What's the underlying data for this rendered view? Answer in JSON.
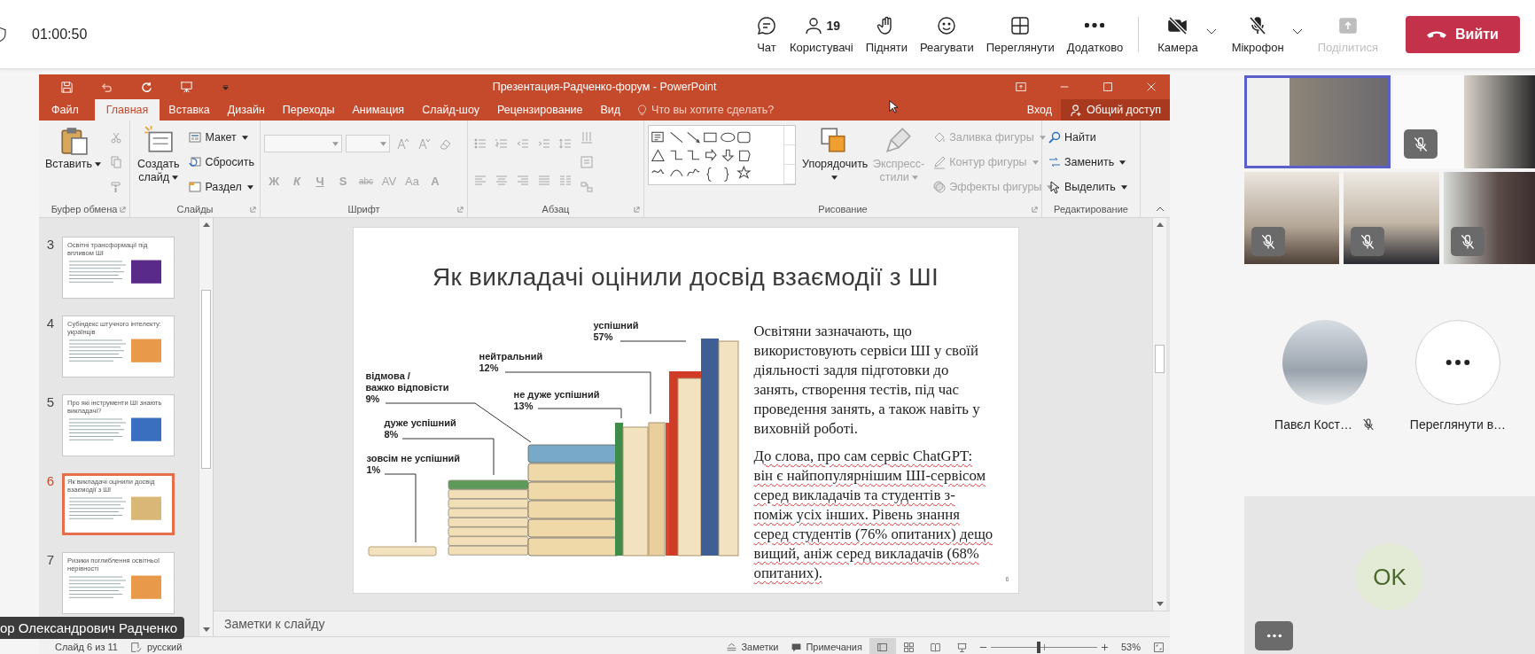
{
  "meeting_toolbar": {
    "timer": "01:00:50",
    "actions": [
      {
        "kind": "chat",
        "label": "Чат"
      },
      {
        "kind": "people",
        "label": "Користувачі",
        "count": "19"
      },
      {
        "kind": "raise-hand",
        "label": "Підняти"
      },
      {
        "kind": "react",
        "label": "Реагувати"
      },
      {
        "kind": "view",
        "label": "Переглянути"
      },
      {
        "kind": "more",
        "label": "Додатково"
      }
    ],
    "camera": {
      "label": "Камера",
      "on": false
    },
    "microphone": {
      "label": "Мікрофон",
      "on": false
    },
    "share": {
      "label": "Поділитися",
      "disabled": true
    },
    "leave": {
      "label": "Вийти"
    }
  },
  "powerpoint": {
    "title": "Презентация-Радченко-форум - PowerPoint",
    "tabs": [
      {
        "label": "Файл",
        "selected": false
      },
      {
        "label": "Главная",
        "selected": true
      },
      {
        "label": "Вставка",
        "selected": false
      },
      {
        "label": "Дизайн",
        "selected": false
      },
      {
        "label": "Переходы",
        "selected": false
      },
      {
        "label": "Анимация",
        "selected": false
      },
      {
        "label": "Слайд-шоу",
        "selected": false
      },
      {
        "label": "Рецензирование",
        "selected": false
      },
      {
        "label": "Вид",
        "selected": false
      }
    ],
    "tell_me": {
      "placeholder": "Что вы хотите сделать?"
    },
    "sign_in": "Вход",
    "share": "Общий доступ",
    "ribbon": [
      {
        "label": "Буфер обмена",
        "items": [
          {
            "kind": "paste",
            "label": "Вставить",
            "dropdown": true,
            "disabled": false
          },
          {
            "kind": "stack",
            "rows": [
              [
                {
                  "kind": "cut",
                  "disabled": true
                }
              ],
              [
                {
                  "kind": "copy",
                  "disabled": true
                }
              ],
              [
                {
                  "kind": "painter",
                  "disabled": true
                }
              ]
            ]
          }
        ]
      },
      {
        "label": "Слайды",
        "items": [
          {
            "kind": "new-slide",
            "label": "Создать слайд",
            "dropdown": true,
            "disabled": false
          },
          {
            "kind": "stack",
            "rows": [
              [
                {
                  "kind": "layout",
                  "label": "Макет",
                  "dropdown": true,
                  "disabled": false
                }
              ],
              [
                {
                  "kind": "reset",
                  "label": "Сбросить",
                  "dropdown": false,
                  "disabled": false
                }
              ],
              [
                {
                  "kind": "section",
                  "label": "Раздел",
                  "dropdown": true,
                  "disabled": false
                }
              ]
            ]
          }
        ]
      },
      {
        "label": "Шрифт",
        "items": [
          {
            "kind": "stack",
            "rows": [
              [
                {
                  "kind": "font-box",
                  "disabled": true
                },
                {
                  "kind": "size-box",
                  "disabled": true
                },
                {
                  "kind": "grow",
                  "disabled": true
                },
                {
                  "kind": "shrink",
                  "disabled": true
                },
                {
                  "kind": "clear",
                  "disabled": true
                }
              ],
              [
                {
                  "kind": "bold",
                  "label": "Ж",
                  "disabled": true
                },
                {
                  "kind": "italic",
                  "label": "К",
                  "disabled": true
                },
                {
                  "kind": "underline",
                  "label": "Ч",
                  "disabled": true
                },
                {
                  "kind": "shadow",
                  "label": "S",
                  "disabled": true
                },
                {
                  "kind": "strike",
                  "label": "abc",
                  "disabled": true
                },
                {
                  "kind": "spacing",
                  "label": "AV",
                  "disabled": true
                },
                {
                  "kind": "case",
                  "label": "Aa",
                  "disabled": true
                },
                {
                  "kind": "color",
                  "label": "A",
                  "disabled": true
                }
              ]
            ]
          }
        ]
      },
      {
        "label": "Абзац",
        "items": [
          {
            "kind": "stack",
            "rows": [
              [
                {
                  "kind": "bullets",
                  "disabled": true
                },
                {
                  "kind": "numbering",
                  "disabled": true
                },
                {
                  "kind": "outdent",
                  "disabled": true
                },
                {
                  "kind": "indent",
                  "disabled": true
                },
                {
                  "kind": "line-spacing",
                  "disabled": true
                }
              ],
              [
                {
                  "kind": "align-left",
                  "disabled": true
                },
                {
                  "kind": "align-center",
                  "disabled": true
                },
                {
                  "kind": "align-right",
                  "disabled": true
                },
                {
                  "kind": "justify",
                  "disabled": true
                },
                {
                  "kind": "columns",
                  "disabled": true
                }
              ]
            ]
          },
          {
            "kind": "stack",
            "rows": [
              [
                {
                  "kind": "text-direction",
                  "disabled": true
                }
              ],
              [
                {
                  "kind": "align-text",
                  "disabled": true
                }
              ],
              [
                {
                  "kind": "smartart",
                  "disabled": true
                }
              ]
            ]
          }
        ]
      },
      {
        "label": "Рисование",
        "items": [
          {
            "kind": "shapes",
            "disabled": false
          },
          {
            "kind": "arrange",
            "label": "Упорядочить",
            "dropdown": true,
            "disabled": false
          },
          {
            "kind": "quick-styles",
            "label": "Экспресс-стили",
            "dropdown": true,
            "disabled": true
          },
          {
            "kind": "stack",
            "rows": [
              [
                {
                  "kind": "fill",
                  "label": "Заливка фигуры",
                  "dropdown": true,
                  "disabled": true
                }
              ],
              [
                {
                  "kind": "outline",
                  "label": "Контур фигуры",
                  "dropdown": true,
                  "disabled": true
                }
              ],
              [
                {
                  "kind": "effects",
                  "label": "Эффекты фигуры",
                  "dropdown": true,
                  "disabled": true
                }
              ]
            ]
          }
        ]
      },
      {
        "label": "Редактирование",
        "items": [
          {
            "kind": "stack",
            "rows": [
              [
                {
                  "kind": "find",
                  "label": "Найти",
                  "dropdown": false,
                  "disabled": false
                }
              ],
              [
                {
                  "kind": "replace",
                  "label": "Заменить",
                  "dropdown": true,
                  "disabled": false
                }
              ],
              [
                {
                  "kind": "select",
                  "label": "Выделить",
                  "dropdown": true,
                  "disabled": false
                }
              ]
            ]
          }
        ]
      }
    ],
    "thumbnails": [
      {
        "number": "3",
        "title": "Освітні трансформації під впливом ШІ",
        "selected": false
      },
      {
        "number": "4",
        "title": "Субіндекс штучного інтелекту: українців",
        "selected": false
      },
      {
        "number": "5",
        "title": "Про які інструменти ШІ знають викладачі?",
        "selected": false
      },
      {
        "number": "6",
        "title": "Як викладачі оцінили досвід взаємодії з ШІ",
        "selected": true
      },
      {
        "number": "7",
        "title": "Ризики поглиблення освітньої нерівності",
        "selected": false
      }
    ],
    "notes_placeholder": "Заметки к слайду",
    "status_bar": {
      "slide_counter": "Слайд 6 из 11",
      "language": "русский",
      "notes": "Заметки",
      "comments": "Примечания",
      "views": [
        {
          "kind": "normal",
          "selected": true
        },
        {
          "kind": "sorter",
          "selected": false
        },
        {
          "kind": "reading",
          "selected": false
        },
        {
          "kind": "slideshow",
          "selected": false
        }
      ],
      "zoom": {
        "level": 0.45,
        "reading": "53%"
      }
    }
  },
  "slide": {
    "title": "Як викладачі оцінили досвід взаємодії з ШІ",
    "labels": [
      {
        "category": "успішний",
        "value": "57%"
      },
      {
        "category": "нейтральний",
        "value": "12%"
      },
      {
        "category": "відмова /\nважко відповісти",
        "value": "9%"
      },
      {
        "category": "не дуже успішний",
        "value": "13%"
      },
      {
        "category": "дуже успішний",
        "value": "8%"
      },
      {
        "category": "зовсім не успішний",
        "value": "1%"
      }
    ],
    "paragraphs": [
      {
        "text": "Освітяни зазначають, що використовують сервіси ШІ у своїй діяльності задля підготовки до занять, створення тестів, під час проведення занять, а також навіть у виховній роботі.",
        "spellcheck": false
      },
      {
        "text": "До слова, про сам сервіс ChatGPT: він є найпопулярнішим ШІ-сервісом серед викладачів та студентів з-поміж усіх інших. Рівень знання серед студентів (76% опитаних) дещо вищий, аніж серед викладачів (68% опитаних).",
        "spellcheck": true
      }
    ],
    "number": "6"
  },
  "presenter": {
    "name": "ор Олександрович Радченко"
  },
  "participants": {
    "tiles": [
      {
        "active_speaker": true,
        "muted": false
      },
      {
        "active_speaker": false,
        "muted": true
      },
      {
        "active_speaker": false,
        "muted": true
      },
      {
        "active_speaker": false,
        "muted": true
      },
      {
        "active_speaker": false,
        "muted": true
      }
    ],
    "roster": [
      {
        "kind": "avatar",
        "name": "Павєл Кост…",
        "muted": true
      },
      {
        "kind": "overflow",
        "name": "Переглянути в…"
      }
    ],
    "self_view": {
      "initials": "OK"
    }
  }
}
